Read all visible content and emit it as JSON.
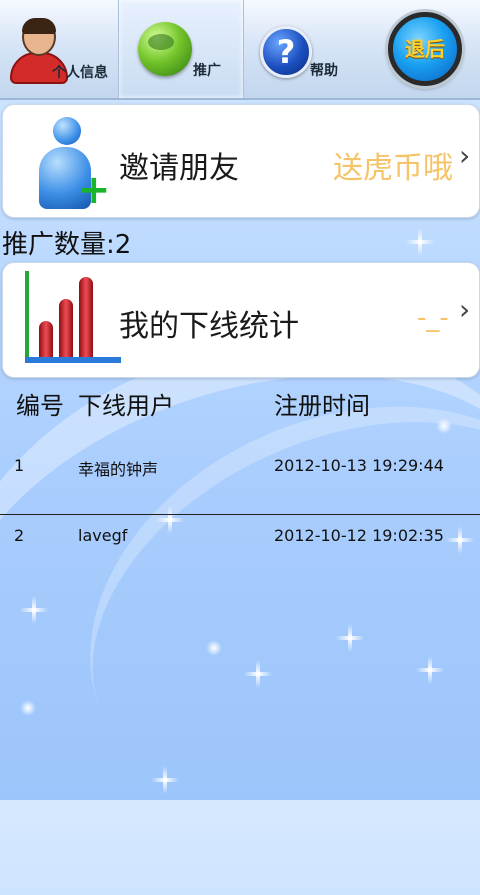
{
  "tabs": [
    {
      "label": "个人信息",
      "icon": "avatar-icon"
    },
    {
      "label": "推广",
      "icon": "globe-icon"
    },
    {
      "label": "帮助",
      "icon": "help-icon"
    }
  ],
  "logout_label": "退后",
  "invite_card": {
    "title": "邀请朋友",
    "extra": "送虎币哦",
    "chevron": "›"
  },
  "promo_count_label": "推广数量:2",
  "stats_card": {
    "title": "我的下线统计",
    "extra": "-_-",
    "chevron": "›"
  },
  "table": {
    "headers": [
      "编号",
      "下线用户",
      "注册时间"
    ],
    "rows": [
      {
        "id": "1",
        "user": "幸福的钟声",
        "time": "2012-10-13 19:29:44"
      },
      {
        "id": "2",
        "user": "lavegf",
        "time": "2012-10-12 19:02:35"
      }
    ]
  },
  "colors": {
    "accent_orange": "#f5c469",
    "tab_bg": "#d7e5f7"
  }
}
